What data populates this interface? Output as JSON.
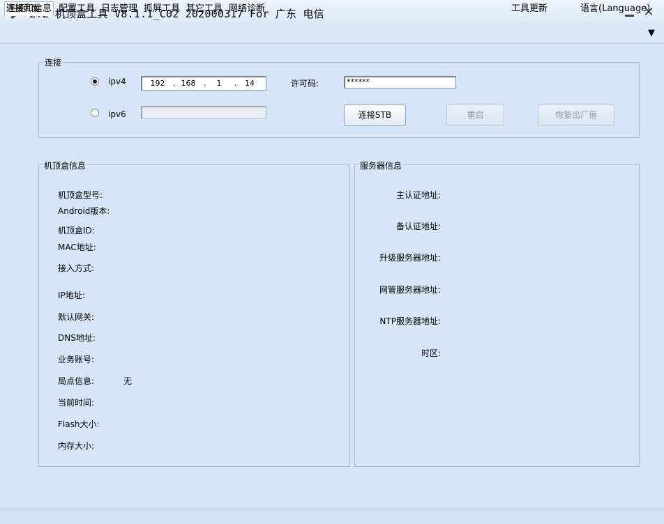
{
  "window": {
    "title": "ZTE 机顶盒工具 V8.1.1_C02 202000317 For 广东 电信"
  },
  "menu": {
    "items": [
      "连接和信息",
      "配置工具",
      "日志管理",
      "抓屏工具",
      "其它工具",
      "网络诊断"
    ],
    "update_label": "工具更新",
    "language_label": "语言(Language)",
    "language_arrow": "▼"
  },
  "connection": {
    "group_title": "连接",
    "ipv4_label": "ipv4",
    "ipv6_label": "ipv6",
    "ipv4_selected": true,
    "ipv4_octets": [
      "192",
      "168",
      "1",
      "14"
    ],
    "ipv6_value": "",
    "license_label": "许可码:",
    "license_value": "******",
    "connect_button": "连接STB",
    "restart_button": "重启",
    "factory_reset_button": "恢复出厂值"
  },
  "stb_info": {
    "group_title": "机顶盒信息",
    "labels": [
      "机顶盒型号:",
      "Android版本:",
      "机顶盒ID:",
      "MAC地址:",
      "接入方式:",
      "IP地址:",
      "默认网关:",
      "DNS地址:",
      "业务账号:",
      "局点信息:",
      "当前时间:",
      "Flash大小:",
      "内存大小:"
    ],
    "site_value": "无"
  },
  "server_info": {
    "group_title": "服务器信息",
    "labels": [
      "主认证地址:",
      "备认证地址:",
      "升级服务器地址:",
      "网管服务器地址:",
      "NTP服务器地址:",
      "时区:"
    ]
  },
  "status": {
    "text": "连接页面"
  }
}
